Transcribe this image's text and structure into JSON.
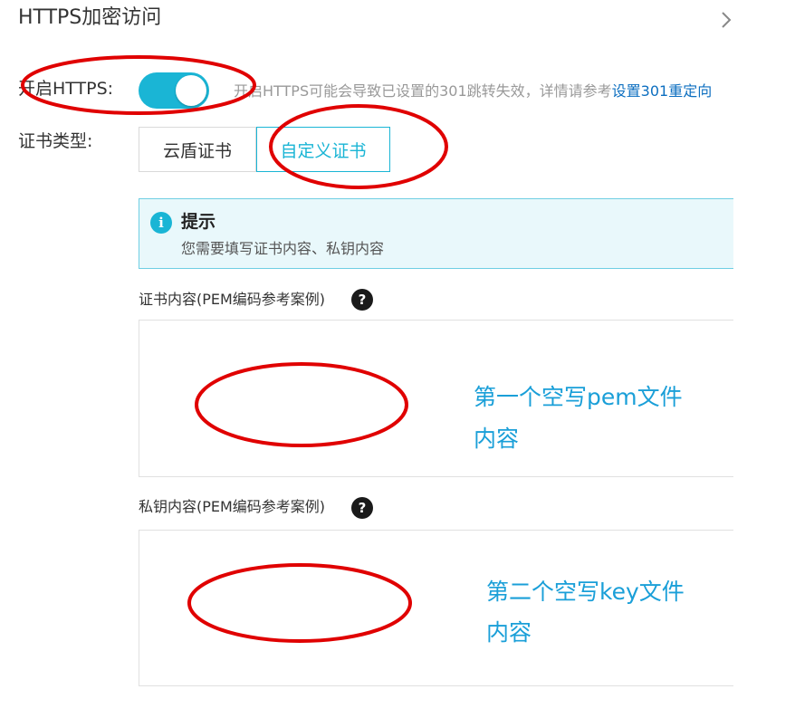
{
  "section": {
    "title": "HTTPS加密访问",
    "expand_icon": "chevron-right-icon"
  },
  "https": {
    "label": "开启HTTPS:",
    "enabled": true,
    "hint_prefix": "开启HTTPS可能会导致已设置的301跳转失效，详情请参考",
    "hint_link": "设置301重定向"
  },
  "cert_type": {
    "label": "证书类型:",
    "options": [
      "云盾证书",
      "自定义证书"
    ],
    "selected": "自定义证书"
  },
  "tip": {
    "icon": "info-icon",
    "title": "提示",
    "text": "您需要填写证书内容、私钥内容"
  },
  "cert_content": {
    "label": "证书内容(PEM编码参考案例)",
    "help_icon": "question-icon",
    "annotation_line1": "第一个空写pem文件",
    "annotation_line2": "内容"
  },
  "private_key": {
    "label": "私钥内容(PEM编码参考案例)",
    "help_icon": "question-icon",
    "annotation_line1": "第二个空写key文件",
    "annotation_line2": "内容"
  },
  "colors": {
    "accent": "#1ab5d5",
    "link": "#0d6fc0",
    "annotation_ring": "#e00000",
    "annotation_text": "#1a9fd8"
  }
}
